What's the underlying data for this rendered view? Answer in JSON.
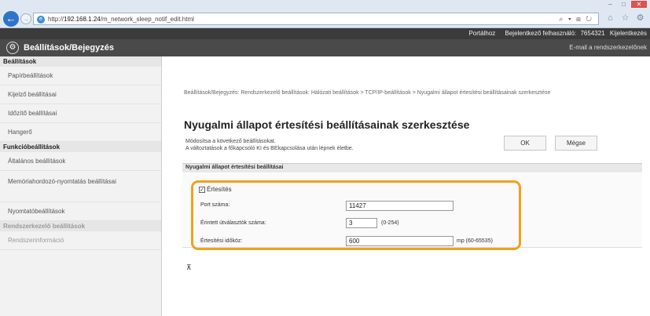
{
  "browser": {
    "url_prefix": "http://",
    "url_host": "192.168.1.24",
    "url_path": "/m_network_sleep_notif_edit.html",
    "addr_tools": "⌕ ▾ ⊞ ↻",
    "back_glyph": "←",
    "forward_glyph": "→",
    "icons": [
      "home-icon",
      "star-icon",
      "gear-icon"
    ],
    "win_controls": [
      "–",
      "□",
      "✕"
    ]
  },
  "top_links": {
    "portal": "Portálhoz",
    "login_user_label": "Bejelentkező felhasználó:",
    "login_user_value": "7654321",
    "logout": "Kijelentkezés"
  },
  "header": {
    "title": "Beállítások/Bejegyzés",
    "mail_link": "E-mail a rendszerkezelőnek"
  },
  "sidebar": {
    "groups": [
      {
        "title": "Beállítások",
        "items": [
          "Papírbeállítások",
          "Kijelző beállításai",
          "Időzítő beállításai",
          "Hangerő"
        ]
      },
      {
        "title": "Funkcióbeállítások",
        "items": [
          "Általános beállítások",
          "Memóriahordozó-nyomtatás beállításai",
          "Nyomtatóbeállítások"
        ]
      },
      {
        "title": "Rendszerkezelő beállítások",
        "items": [
          "Rendszerinformáció"
        ]
      }
    ]
  },
  "main": {
    "breadcrumb": "Beállítások/Bejegyzés: Rendszerkezelő beállítások: Hálózati beállítások > TCP/IP-beállítások > Nyugalmi állapot értesítési beállításainak szerkesztése",
    "page_title": "Nyugalmi állapot értesítési beállításainak szerkesztése",
    "instruction_line1": "Módosítsa a következő beállításokat.",
    "instruction_line2": "A változtatások a főkapcsoló KI és BEkapcsolása után lépnek életbe.",
    "ok_label": "OK",
    "cancel_label": "Mégse",
    "section_title": "Nyugalmi állapot értesítési beállításai",
    "notify_label": "Értesítés",
    "notify_checked": true,
    "port_label": "Port száma:",
    "port_value": "11427",
    "router_label": "Érintett útválasztók száma:",
    "router_value": "3",
    "router_hint": "(0-254)",
    "interval_label": "Értesítési időköz:",
    "interval_value": "600",
    "interval_hint": "mp (60-65535)",
    "collapse_glyph": "⊼",
    "highlight_color": "#f0a020"
  }
}
